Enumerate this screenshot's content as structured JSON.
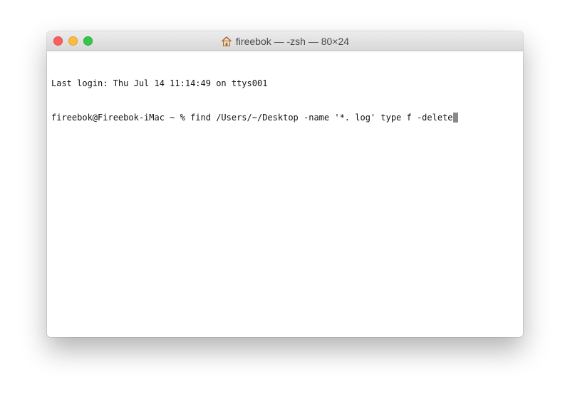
{
  "window": {
    "title": "fireebok — -zsh — 80×24",
    "title_icon": "home-icon"
  },
  "terminal": {
    "lines": [
      "Last login: Thu Jul 14 11:14:49 on ttys001",
      "fireebok@Fireebok-iMac ~ % find /Users/~/Desktop -name '*. log' type f -delete"
    ]
  },
  "colors": {
    "close": "#fc605c",
    "minimize": "#fdbc40",
    "zoom": "#34c84a",
    "cursor": "#8a8a8a"
  }
}
